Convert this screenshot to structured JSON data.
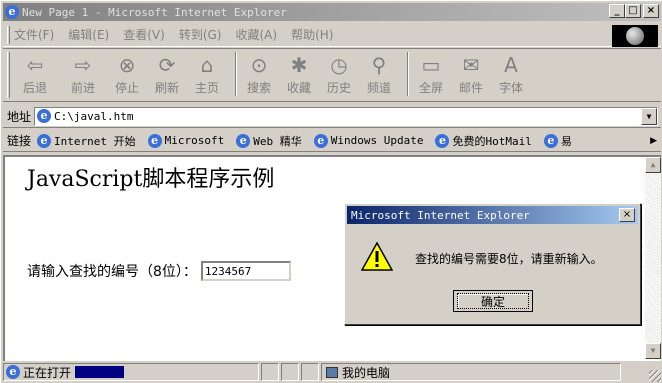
{
  "window": {
    "title": "New Page 1 - Microsoft Internet Explorer",
    "minimize": "_",
    "maximize": "□",
    "close": "×"
  },
  "menu": [
    "文件(F)",
    "编辑(E)",
    "查看(V)",
    "转到(G)",
    "收藏(A)",
    "帮助(H)"
  ],
  "toolbar": [
    {
      "name": "back",
      "label": "后退",
      "icon": "arrow-left-icon",
      "glyph": "⇦"
    },
    {
      "name": "forward",
      "label": "前进",
      "icon": "arrow-right-icon",
      "glyph": "⇨"
    },
    {
      "name": "stop",
      "label": "停止",
      "icon": "stop-icon",
      "glyph": "⊗"
    },
    {
      "name": "refresh",
      "label": "刷新",
      "icon": "refresh-icon",
      "glyph": "⟳"
    },
    {
      "name": "home",
      "label": "主页",
      "icon": "home-icon",
      "glyph": "⌂"
    },
    {
      "name": "search",
      "label": "搜索",
      "icon": "search-icon",
      "glyph": "⊙"
    },
    {
      "name": "favorites",
      "label": "收藏",
      "icon": "favorites-icon",
      "glyph": "✱"
    },
    {
      "name": "history",
      "label": "历史",
      "icon": "history-icon",
      "glyph": "◷"
    },
    {
      "name": "channels",
      "label": "频道",
      "icon": "channels-icon",
      "glyph": "⚲"
    },
    {
      "name": "fullscreen",
      "label": "全屏",
      "icon": "fullscreen-icon",
      "glyph": "▭"
    },
    {
      "name": "mail",
      "label": "邮件",
      "icon": "mail-icon",
      "glyph": "✉"
    },
    {
      "name": "font",
      "label": "字体",
      "icon": "font-icon",
      "glyph": "A"
    }
  ],
  "address": {
    "label": "地址",
    "value": "C:\\javal.htm"
  },
  "links": {
    "label": "链接",
    "items": [
      "Internet 开始",
      "Microsoft",
      "Web 精华",
      "Windows Update",
      "免费的HotMail",
      "易"
    ]
  },
  "page": {
    "heading": "JavaScript脚本程序示例",
    "prompt": "请输入查找的编号（8位）：",
    "input_value": "1234567"
  },
  "dialog": {
    "title": "Microsoft Internet Explorer",
    "message": "查找的编号需要8位，请重新输入。",
    "ok": "确定",
    "close": "×"
  },
  "status": {
    "text": "正在打开",
    "zone": "我的电脑",
    "progress": 0.35
  }
}
